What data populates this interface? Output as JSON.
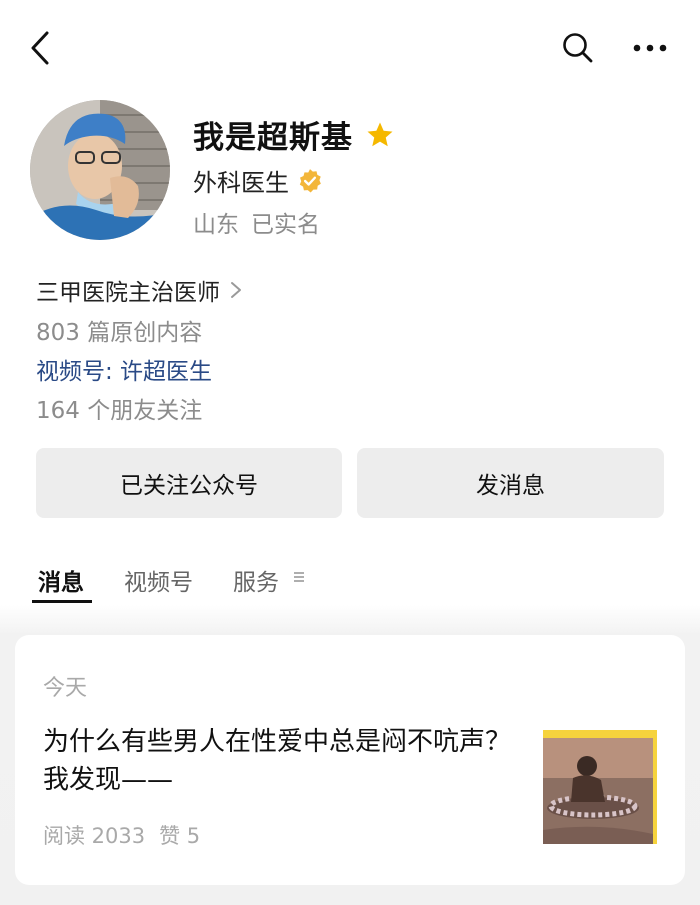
{
  "profile": {
    "name": "我是超斯基",
    "title": "外科医生",
    "location": "山东",
    "real_name_status": "已实名"
  },
  "info": {
    "position": "三甲医院主治医师",
    "articles": "803 篇原创内容",
    "video_account": "视频号: 许超医生",
    "friends_following": "164 个朋友关注"
  },
  "buttons": {
    "follow": "已关注公众号",
    "message": "发消息"
  },
  "tabs": {
    "messages": "消息",
    "video": "视频号",
    "services": "服务"
  },
  "feed": {
    "date": "今天",
    "title": "为什么有些男人在性爱中总是闷不吭声？我发现——",
    "reads": "阅读 2033",
    "likes": "赞 5"
  },
  "colors": {
    "link_blue": "#2a4a86",
    "star_yellow": "#f5b800",
    "verified_badge": "#f3b63a"
  }
}
